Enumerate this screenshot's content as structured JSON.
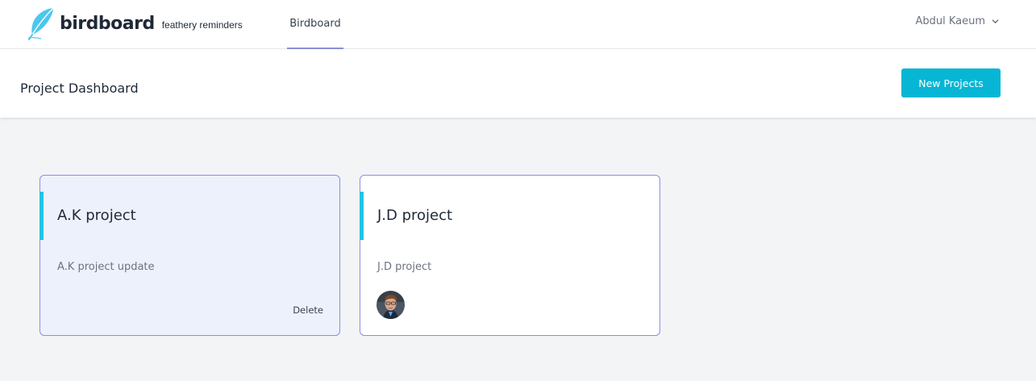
{
  "nav": {
    "brand": "birdboard",
    "tagline": "feathery reminders",
    "link": "Birdboard",
    "user": "Abdul Kaeum"
  },
  "header": {
    "title": "Project Dashboard",
    "new_button": "New Projects"
  },
  "projects": [
    {
      "title": "A.K project",
      "description": "A.K project update",
      "action": "Delete"
    },
    {
      "title": "J.D project",
      "description": "J.D project"
    }
  ],
  "colors": {
    "accent": "#06b6d4",
    "card_border": "#8c8fde",
    "card_stripe": "#22c3e6"
  },
  "icons": [
    "feather-logo-icon",
    "chevron-down-icon"
  ]
}
